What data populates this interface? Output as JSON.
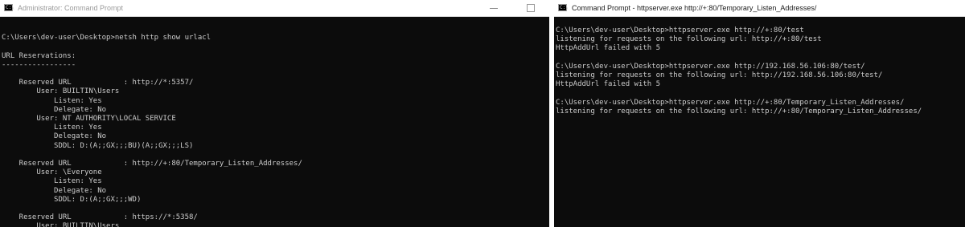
{
  "left_window": {
    "title": "Administrator: Command Prompt",
    "icon": "cmd-icon",
    "controls": {
      "minimize": "minimize-icon",
      "maximize": "maximize-icon"
    },
    "lines": [
      "",
      "C:\\Users\\dev-user\\Desktop>netsh http show urlacl",
      "",
      "URL Reservations:",
      "-----------------",
      "",
      "    Reserved URL            : http://*:5357/",
      "        User: BUILTIN\\Users",
      "            Listen: Yes",
      "            Delegate: No",
      "        User: NT AUTHORITY\\LOCAL SERVICE",
      "            Listen: Yes",
      "            Delegate: No",
      "            SDDL: D:(A;;GX;;;BU)(A;;GX;;;LS)",
      "",
      "    Reserved URL            : http://+:80/Temporary_Listen_Addresses/",
      "        User: \\Everyone",
      "            Listen: Yes",
      "            Delegate: No",
      "            SDDL: D:(A;;GX;;;WD)",
      "",
      "    Reserved URL            : https://*:5358/",
      "        User: BUILTIN\\Users"
    ]
  },
  "right_window": {
    "title": "Command Prompt - httpserver.exe  http://+:80/Temporary_Listen_Addresses/",
    "icon": "cmd-icon",
    "lines": [
      "C:\\Users\\dev-user\\Desktop>httpserver.exe http://+:80/test",
      "listening for requests on the following url: http://+:80/test",
      "HttpAddUrl failed with 5",
      "",
      "C:\\Users\\dev-user\\Desktop>httpserver.exe http://192.168.56.106:80/test/",
      "listening for requests on the following url: http://192.168.56.106:80/test/",
      "HttpAddUrl failed with 5",
      "",
      "C:\\Users\\dev-user\\Desktop>httpserver.exe http://+:80/Temporary_Listen_Addresses/",
      "listening for requests on the following url: http://+:80/Temporary_Listen_Addresses/"
    ]
  },
  "colors": {
    "console_bg": "#0c0c0c",
    "console_fg": "#cccccc",
    "titlebar_bg": "#ffffff"
  }
}
